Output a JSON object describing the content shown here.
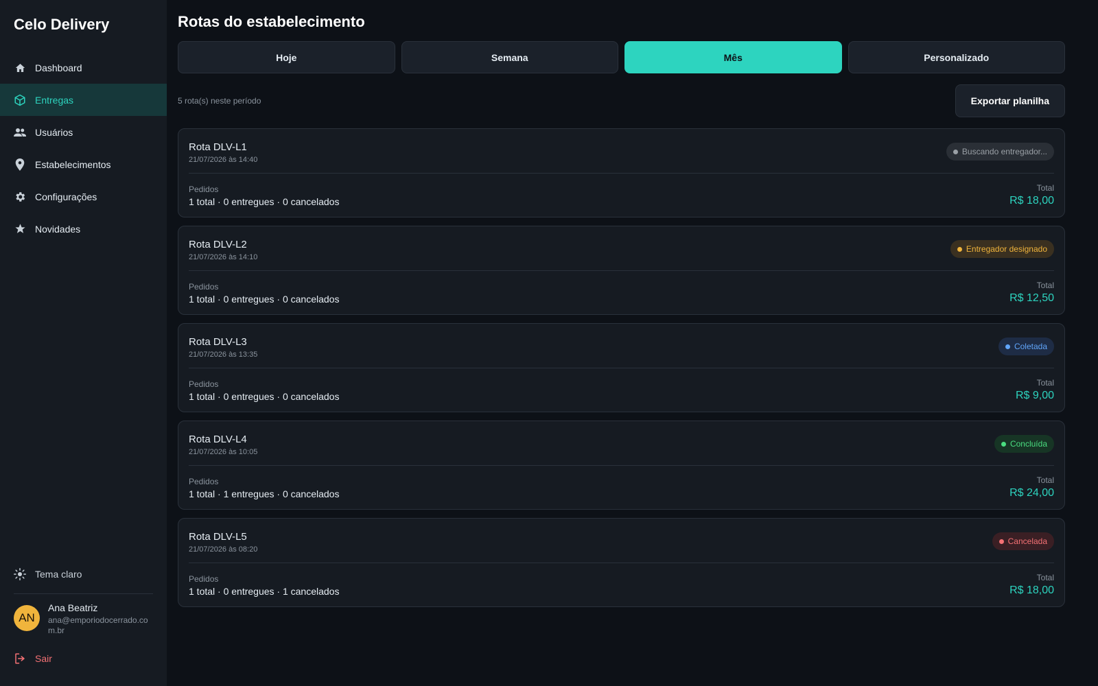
{
  "app": {
    "title": "Celo Delivery"
  },
  "sidebar": {
    "items": [
      {
        "label": "Dashboard",
        "icon": "home-icon",
        "active": false
      },
      {
        "label": "Entregas",
        "icon": "box-icon",
        "active": true
      },
      {
        "label": "Usuários",
        "icon": "users-icon",
        "active": false
      },
      {
        "label": "Estabelecimentos",
        "icon": "pin-icon",
        "active": false
      },
      {
        "label": "Configurações",
        "icon": "gear-icon",
        "active": false
      },
      {
        "label": "Novidades",
        "icon": "star-icon",
        "active": false
      }
    ],
    "theme_label": "Tema claro",
    "user": {
      "initials": "AN",
      "name": "Ana Beatriz",
      "email": "ana@emporiodocerrado.com.br"
    },
    "logout_label": "Sair"
  },
  "main": {
    "title": "Rotas do estabelecimento",
    "tabs": [
      {
        "label": "Hoje",
        "active": false
      },
      {
        "label": "Semana",
        "active": false
      },
      {
        "label": "Mês",
        "active": true
      },
      {
        "label": "Personalizado",
        "active": false
      }
    ],
    "count_text": "5 rota(s) neste período",
    "export_label": "Exportar planilha",
    "orders_label": "Pedidos",
    "total_label": "Total",
    "routes": [
      {
        "name": "Rota DLV-L1",
        "date": "21/07/2026 às 14:40",
        "status": "Buscando entregador...",
        "status_color": "#9aa0a6",
        "status_bg": "#2a2f36",
        "orders": "1 total · 0 entregues · 0 cancelados",
        "total": "R$ 18,00"
      },
      {
        "name": "Rota DLV-L2",
        "date": "21/07/2026 às 14:10",
        "status": "Entregador designado",
        "status_color": "#f0b43c",
        "status_bg": "#3a3020",
        "orders": "1 total · 0 entregues · 0 cancelados",
        "total": "R$ 12,50"
      },
      {
        "name": "Rota DLV-L3",
        "date": "21/07/2026 às 13:35",
        "status": "Coletada",
        "status_color": "#60a5fa",
        "status_bg": "#1e2c45",
        "orders": "1 total · 0 entregues · 0 cancelados",
        "total": "R$ 9,00"
      },
      {
        "name": "Rota DLV-L4",
        "date": "21/07/2026 às 10:05",
        "status": "Concluída",
        "status_color": "#4ade80",
        "status_bg": "#173525",
        "orders": "1 total · 1 entregues · 0 cancelados",
        "total": "R$ 24,00"
      },
      {
        "name": "Rota DLV-L5",
        "date": "21/07/2026 às 08:20",
        "status": "Cancelada",
        "status_color": "#f47174",
        "status_bg": "#3a1f24",
        "orders": "1 total · 0 entregues · 1 cancelados",
        "total": "R$ 18,00"
      }
    ]
  }
}
